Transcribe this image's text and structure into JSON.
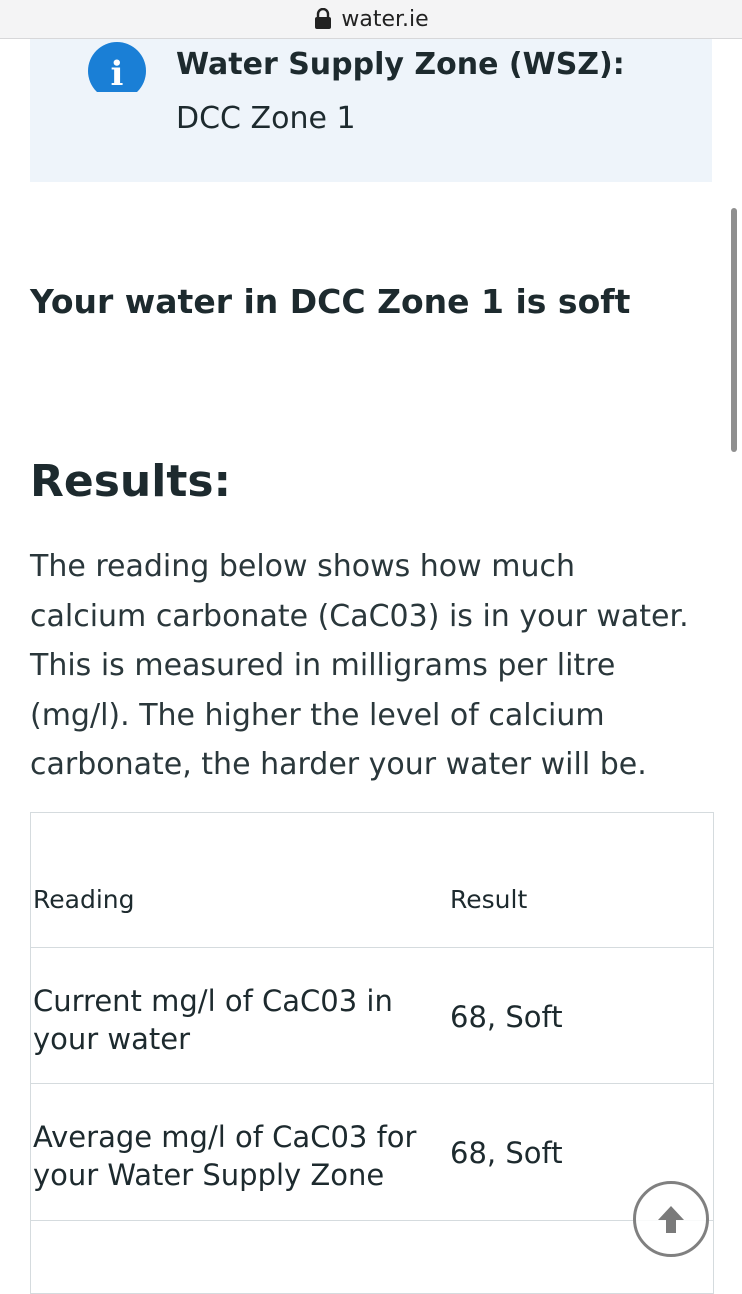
{
  "browser": {
    "url": "water.ie"
  },
  "info": {
    "title": "Water Supply Zone (WSZ):",
    "value": "DCC Zone 1",
    "icon": "info-icon",
    "icon_color": "#1a7fd6"
  },
  "main": {
    "soft_heading": "Your water in DCC Zone 1 is soft",
    "results_heading": "Results:",
    "description": "The reading below shows how much calcium carbonate (CaC03) is in your water. This is measured in milligrams per litre (mg/l). The higher the level of calcium carbonate, the harder your water will be."
  },
  "table": {
    "headers": {
      "reading": "Reading",
      "result": "Result"
    },
    "rows": [
      {
        "reading": "Current mg/l of CaC03 in your water",
        "result": "68, Soft"
      },
      {
        "reading": "Average mg/l of CaC03 for your Water Supply Zone",
        "result": "68, Soft"
      }
    ]
  },
  "controls": {
    "scroll_top_icon": "arrow-up-icon"
  }
}
